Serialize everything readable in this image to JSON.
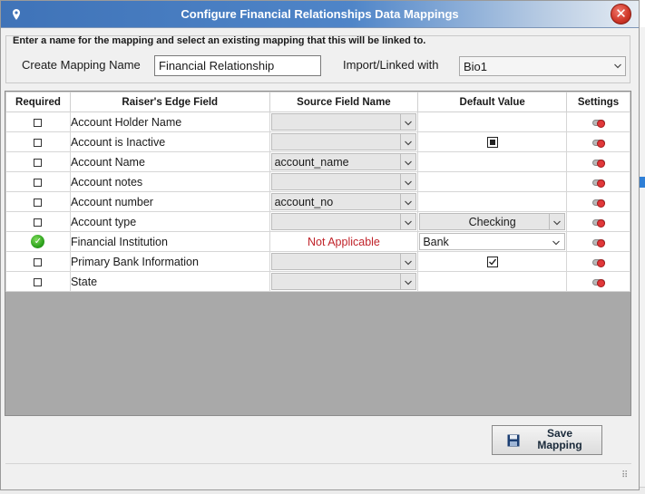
{
  "dialog": {
    "title": "Configure Financial Relationships Data Mappings",
    "close_label": "✕"
  },
  "instructions": "Enter a name for the mapping and select an existing mapping that this will be linked to.",
  "form": {
    "create_label": "Create Mapping Name",
    "mapping_name_value": "Financial Relationship",
    "import_label": "Import/Linked with",
    "import_value": "Bio1"
  },
  "grid": {
    "headers": [
      "Required",
      "Raiser's Edge Field",
      "Source Field Name",
      "Default Value",
      "Settings"
    ],
    "rows": [
      {
        "required": "checkbox",
        "field": "Account Holder Name",
        "source": "",
        "source_type": "combo",
        "default_type": "none"
      },
      {
        "required": "checkbox",
        "field": "Account is Inactive",
        "source": "",
        "source_type": "combo",
        "default_type": "checkbox-filled"
      },
      {
        "required": "checkbox",
        "field": "Account Name",
        "source": "account_name",
        "source_type": "combo",
        "default_type": "none"
      },
      {
        "required": "checkbox",
        "field": "Account notes",
        "source": "",
        "source_type": "combo",
        "default_type": "none"
      },
      {
        "required": "checkbox",
        "field": "Account number",
        "source": "account_no",
        "source_type": "combo",
        "default_type": "none"
      },
      {
        "required": "checkbox",
        "field": "Account type",
        "source": "",
        "source_type": "combo",
        "default_type": "select",
        "default_value": "Checking"
      },
      {
        "required": "check-icon",
        "field": "Financial Institution",
        "source": "Not Applicable",
        "source_type": "text",
        "default_type": "select-white",
        "default_value": "Bank"
      },
      {
        "required": "checkbox",
        "field": "Primary Bank Information",
        "source": "",
        "source_type": "combo",
        "default_type": "checkbox-ticked"
      },
      {
        "required": "checkbox",
        "field": "State",
        "source": "",
        "source_type": "combo",
        "default_type": "none"
      }
    ]
  },
  "save_button": {
    "line1": "Save",
    "line2": "Mapping"
  },
  "colors": {
    "title_blue": "#3f73b8",
    "not_applicable_red": "#c0232a",
    "grid_empty_gray": "#a9a9a9"
  }
}
